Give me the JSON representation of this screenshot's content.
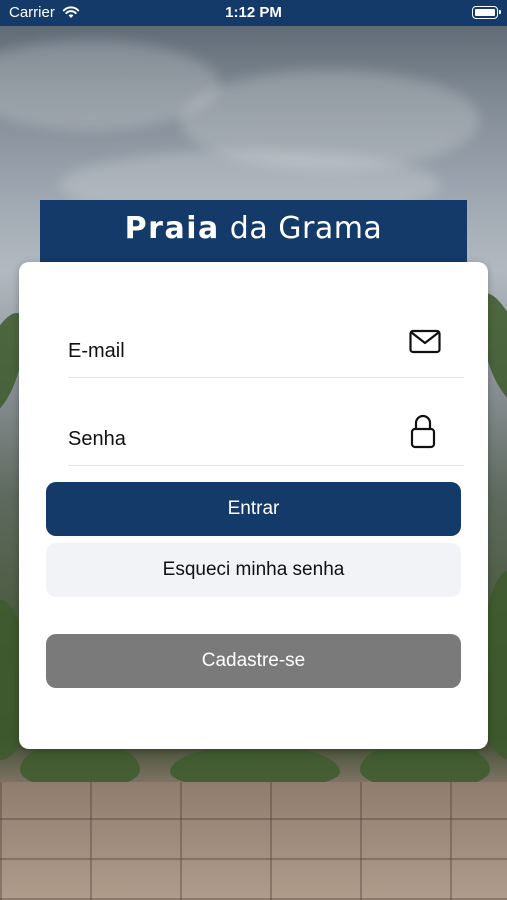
{
  "status_bar": {
    "carrier": "Carrier",
    "time": "1:12 PM"
  },
  "header": {
    "title_part1": "Praia",
    "title_part2": "da Grama"
  },
  "login_form": {
    "email_label": "E-mail",
    "password_label": "Senha",
    "login_button": "Entrar",
    "forgot_password_button": "Esqueci minha senha",
    "signup_button": "Cadastre-se"
  },
  "colors": {
    "primary": "#133a69",
    "secondary_button": "#f2f3f7",
    "signup_button": "#7a7a7a"
  },
  "icons": {
    "email": "envelope-icon",
    "password": "lock-icon",
    "wifi": "wifi-icon",
    "battery": "battery-icon"
  }
}
